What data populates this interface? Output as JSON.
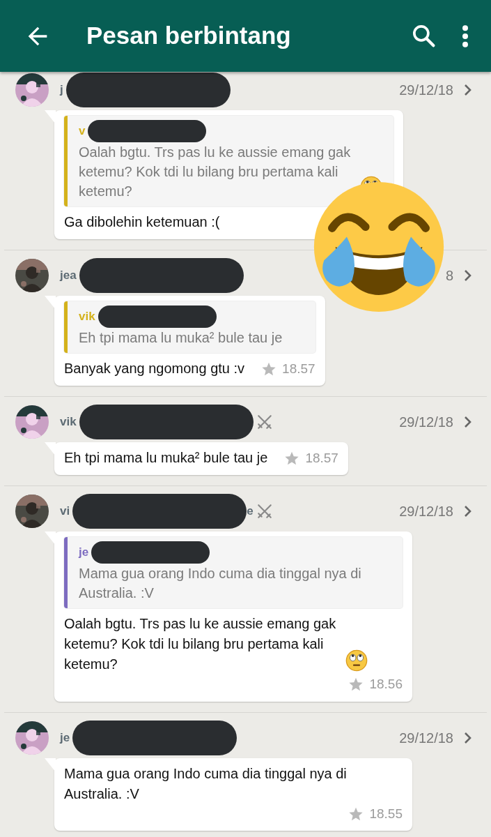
{
  "header": {
    "title": "Pesan berbintang"
  },
  "messages": [
    {
      "sender": {
        "prefix": "j"
      },
      "date": "29/12/18",
      "quote": {
        "sender_prefix": "v",
        "color": "#d4b21c",
        "text": "Oalah bgtu. Trs pas lu ke aussie emang gak ketemu? Kok tdi lu bilang bru pertama kali ketemu?",
        "ends_with_emoji": true
      },
      "text": "Ga dibolehin ketemuan :("
    },
    {
      "sender": {
        "prefix": "jea"
      },
      "date": "8",
      "quote": {
        "sender_prefix": "vik",
        "color": "#d4b21c",
        "text": "Eh tpi mama lu muka² bule tau je"
      },
      "text": "Banyak yang ngomong gtu :v",
      "time": "18.57"
    },
    {
      "sender": {
        "prefix": "vik",
        "swords": true
      },
      "date": "29/12/18",
      "text": "Eh tpi mama lu muka² bule tau je",
      "time": "18.57"
    },
    {
      "sender": {
        "prefix": "vi",
        "suffix": "e",
        "swords": true
      },
      "date": "29/12/18",
      "quote": {
        "sender_prefix": "je",
        "color": "#7d6cc0",
        "text": "Mama gua orang Indo cuma dia tinggal nya di Australia. :V"
      },
      "text": "Oalah bgtu. Trs pas lu ke aussie emang gak ketemu? Kok tdi lu bilang bru pertama kali ketemu?",
      "ends_with_emoji": true,
      "time": "18.56"
    },
    {
      "sender": {
        "prefix": "je"
      },
      "date": "29/12/18",
      "text": "Mama gua orang Indo cuma dia tinggal nya di Australia. :V",
      "time": "18.55"
    }
  ]
}
